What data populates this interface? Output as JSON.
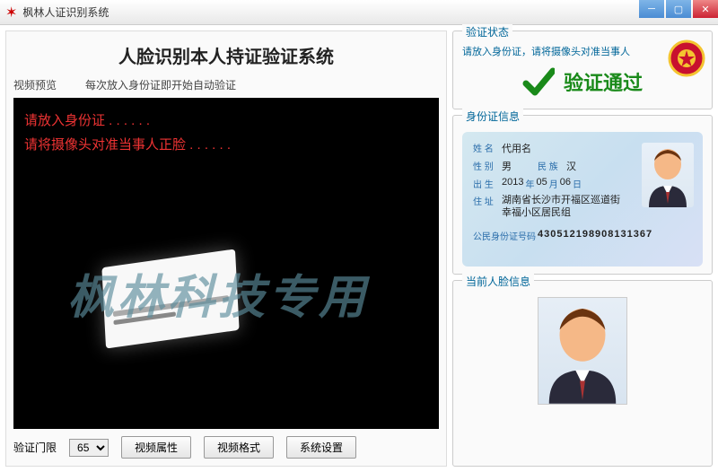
{
  "window": {
    "title": "枫林人证识别系统"
  },
  "main": {
    "heading": "人脸识别本人持证验证系统",
    "preview_label": "视频预览",
    "auto_hint": "每次放入身份证即开始自动验证",
    "overlay_line1": "请放入身份证 . . . . . .",
    "overlay_line2": "请将摄像头对准当事人正脸 . . . . . .",
    "watermark": "枫林科技专用"
  },
  "toolbar": {
    "threshold_label": "验证门限",
    "threshold_value": "65",
    "video_props": "视频属性",
    "video_format": "视频格式",
    "system_settings": "系统设置"
  },
  "status": {
    "group_title": "验证状态",
    "instruction": "请放入身份证，请将摄像头对准当事人",
    "result": "验证通过"
  },
  "idinfo": {
    "group_title": "身份证信息",
    "labels": {
      "name": "姓 名",
      "sex": "性 别",
      "nation": "民 族",
      "birth": "出 生",
      "address": "住 址",
      "idnum": "公民身份证号码"
    },
    "name": "代用名",
    "sex": "男",
    "nation": "汉",
    "birth_y": "2013",
    "birth_m": "05",
    "birth_d": "06",
    "birth_ylab": "年",
    "birth_mlab": "月",
    "birth_dlab": "日",
    "address": "湖南省长沙市开福区巡道街幸福小区居民组",
    "idnum": "430512198908131367"
  },
  "current_face": {
    "group_title": "当前人脸信息"
  }
}
